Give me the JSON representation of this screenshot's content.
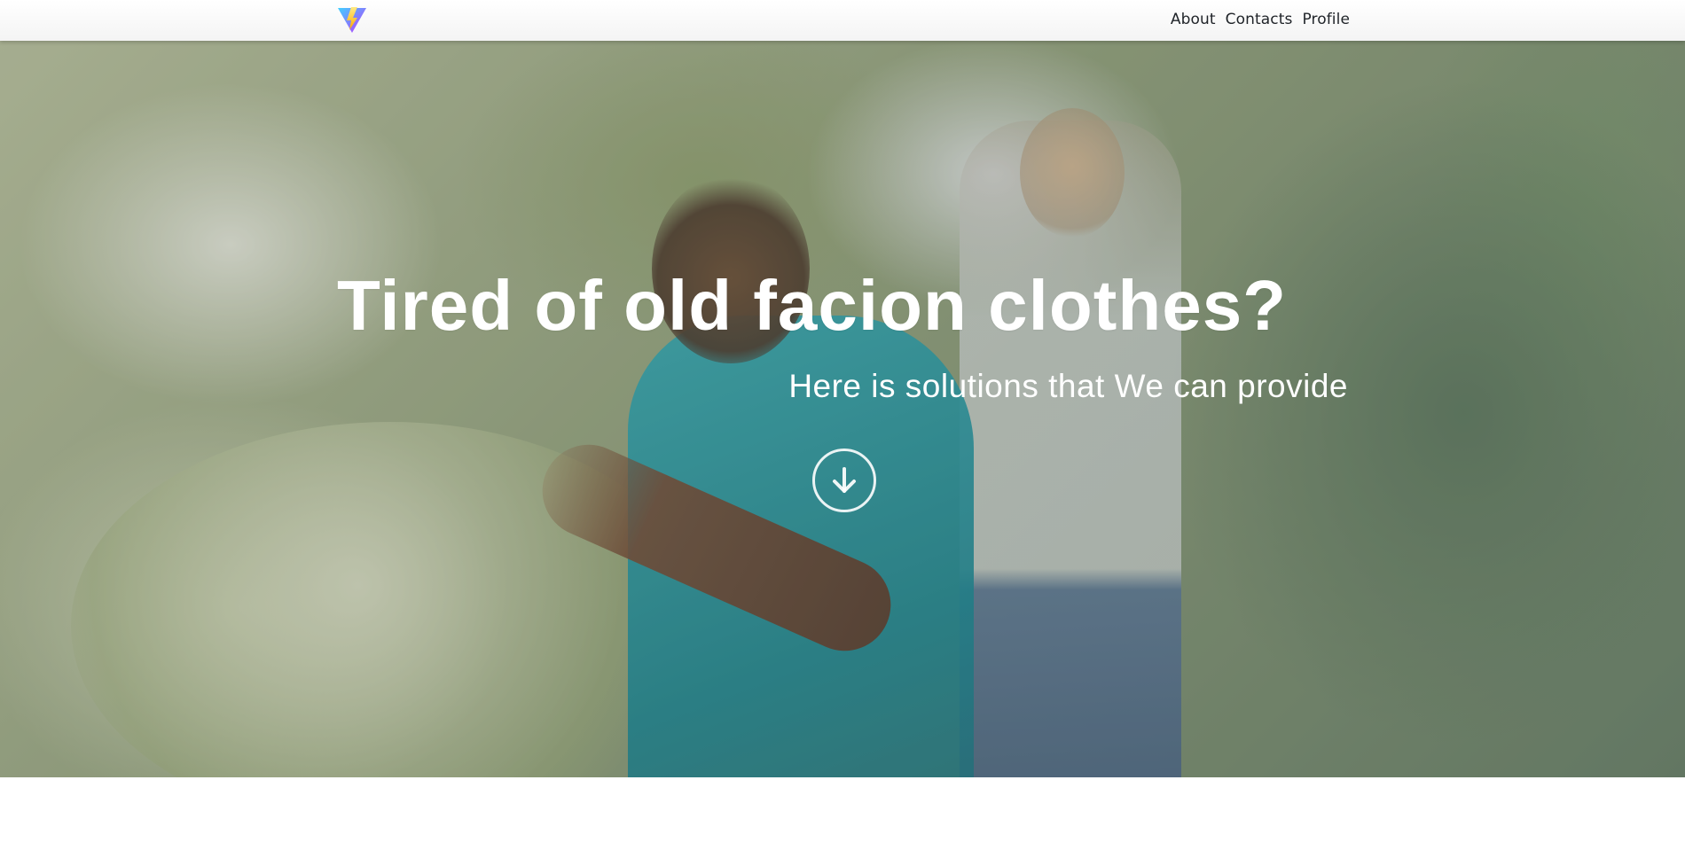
{
  "header": {
    "logo_icon": "vite-logo-icon",
    "nav": [
      {
        "label": "About"
      },
      {
        "label": "Contacts"
      },
      {
        "label": "Profile"
      }
    ]
  },
  "hero": {
    "headline": "Tired of old facion clothes?",
    "subheadline": "Here is solutions that We can provide",
    "scroll_icon": "arrow-down-circle-icon"
  },
  "colors": {
    "navbar_background": "#f4f4f4",
    "hero_text": "#ffffff",
    "logo_purple": "#8b5cf6",
    "logo_yellow": "#ffd43b"
  }
}
